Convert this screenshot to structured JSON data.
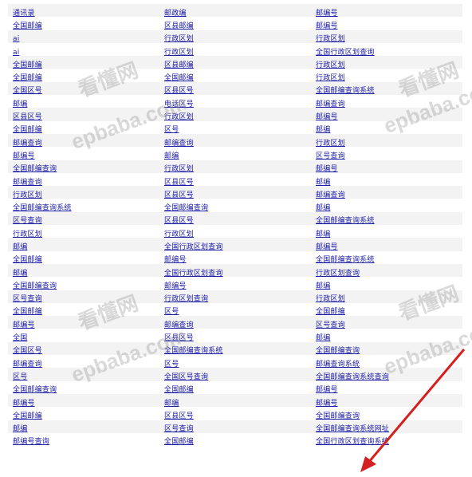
{
  "links": [
    [
      "通讯录",
      "邮政编",
      "邮编号"
    ],
    [
      "全国邮编",
      "区县邮编",
      "邮编号"
    ],
    [
      "ai",
      "行政区划",
      "行政区划"
    ],
    [
      "ai",
      "行政区划",
      "全国行政区划查询"
    ],
    [
      "全国邮编",
      "区县邮编",
      "行政区划"
    ],
    [
      "全国邮编",
      "全国邮编",
      "行政区划"
    ],
    [
      "全国区号",
      "区县区号",
      "全国邮编查询系统"
    ],
    [
      "邮编",
      "电话区号",
      "邮编查询"
    ],
    [
      "区县区号",
      "行政区划",
      "邮编号"
    ],
    [
      "全国邮编",
      "区号",
      "邮编"
    ],
    [
      "邮编查询",
      "邮编查询",
      "行政区划"
    ],
    [
      "邮编号",
      "邮编",
      "区号查询"
    ],
    [
      "全国邮编查询",
      "行政区划",
      "邮编号"
    ],
    [
      "邮编查询",
      "区县区号",
      "邮编"
    ],
    [
      "行政区划",
      "区县区号",
      "邮编查询"
    ],
    [
      "全国邮编查询系统",
      "全国邮编查询",
      "邮编"
    ],
    [
      "区号查询",
      "区县区号",
      "全国邮编查询系统"
    ],
    [
      "行政区划",
      "行政区划",
      "邮编"
    ],
    [
      "邮编",
      "全国行政区划查询",
      "邮编号"
    ],
    [
      "全国邮编",
      "邮编号",
      "全国邮编查询系统"
    ],
    [
      "邮编",
      "全国行政区划查询",
      "行政区划查询"
    ],
    [
      "全国邮编查询",
      "邮编号",
      "邮编"
    ],
    [
      "区号查询",
      "行政区划查询",
      "行政区划"
    ],
    [
      "全国邮编",
      "区号",
      "全国邮编"
    ],
    [
      "邮编号",
      "邮编查询",
      "区号查询"
    ],
    [
      "全国",
      "区县区号",
      "邮编"
    ],
    [
      "全国区号",
      "全国邮编查询系统",
      "全国邮编查询"
    ],
    [
      "邮编查询",
      "区号",
      "邮编查询系统"
    ],
    [
      "区号",
      "全国区号查询",
      "全国邮编查询系统查询"
    ],
    [
      "全国邮编查询",
      "全国邮编",
      "邮编号"
    ],
    [
      "邮编号",
      "邮编",
      "邮编号"
    ],
    [
      "全国邮编",
      "区县区号",
      "全国邮编查询"
    ],
    [
      "邮编",
      "区号查询",
      "全国邮编查询系统网址"
    ],
    [
      "邮编号查询",
      "全国邮编",
      "全国行政区划查询系统"
    ]
  ],
  "watermarks": {
    "cn": "看懂网",
    "en": "epbaba.com"
  },
  "colors": {
    "link": "#1a1aa8",
    "arrow": "#d42020"
  }
}
